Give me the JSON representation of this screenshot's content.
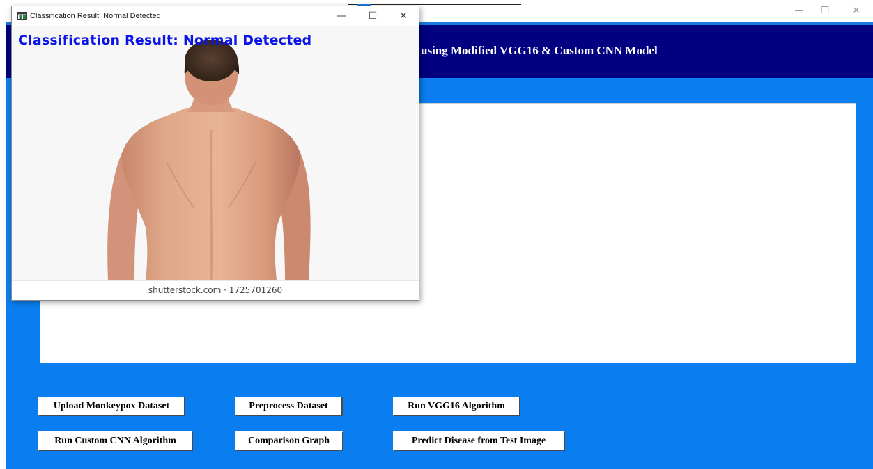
{
  "main_window": {
    "header_title": "using Modified VGG16 & Custom CNN Model",
    "buttons": {
      "upload_dataset": "Upload Monkeypox Dataset",
      "preprocess_dataset": "Preprocess Dataset",
      "run_vgg16": "Run VGG16 Algorithm",
      "run_custom_cnn": "Run Custom CNN Algorithm",
      "comparison_graph": "Comparison Graph",
      "predict_disease": "Predict Disease from Test Image"
    },
    "controls": {
      "minimize_glyph": "—",
      "restore_glyph": "❐",
      "close_glyph": "✕"
    }
  },
  "popup": {
    "window_title": "Classification Result: Normal Detected",
    "result_text": "Classification Result: Normal Detected",
    "watermark": "shutterstock.com · 1725701260",
    "controls": {
      "minimize_glyph": "—",
      "maximize_glyph": "☐",
      "close_glyph": "✕"
    }
  },
  "colors": {
    "header_bg": "#000080",
    "body_bg": "#0a7ef0",
    "result_text": "#0a14e6"
  },
  "icons": {
    "popup_app": "app-window-icon"
  }
}
